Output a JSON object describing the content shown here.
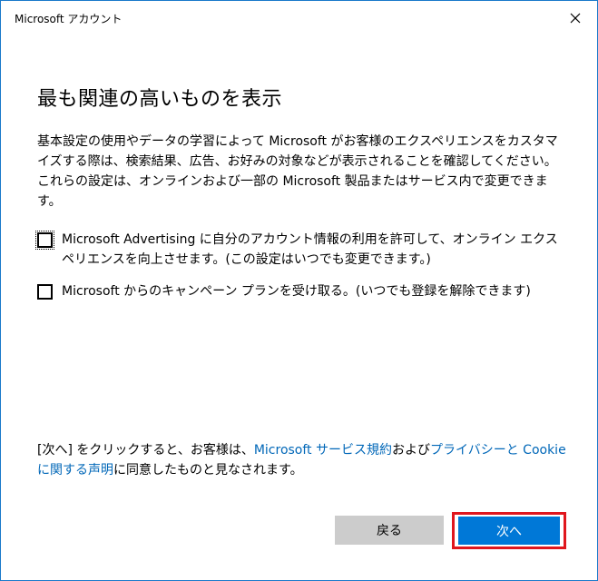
{
  "window": {
    "title": "Microsoft アカウント"
  },
  "heading": "最も関連の高いものを表示",
  "description": "基本設定の使用やデータの学習によって Microsoft がお客様のエクスペリエンスをカスタマイズする際は、検索結果、広告、お好みの対象などが表示されることを確認してください。これらの設定は、オンラインおよび一部の Microsoft 製品またはサービス内で変更できます。",
  "options": [
    {
      "label": "Microsoft Advertising に自分のアカウント情報の利用を許可して、オンライン エクスペリエンスを向上させます。(この設定はいつでも変更できます。)",
      "checked": false
    },
    {
      "label": "Microsoft からのキャンペーン プランを受け取る。(いつでも登録を解除できます)",
      "checked": false
    }
  ],
  "legal": {
    "prefix": "[次へ] をクリックすると、お客様は、",
    "link1": "Microsoft サービス規約",
    "middle": "および",
    "link2": "プライバシーと Cookie に関する声明",
    "suffix": "に同意したものと見なされます。"
  },
  "buttons": {
    "back": "戻る",
    "next": "次へ"
  },
  "colors": {
    "accent": "#0078d7",
    "link": "#0067b8",
    "highlight": "#e0161d",
    "secondary_button": "#cccccc"
  }
}
